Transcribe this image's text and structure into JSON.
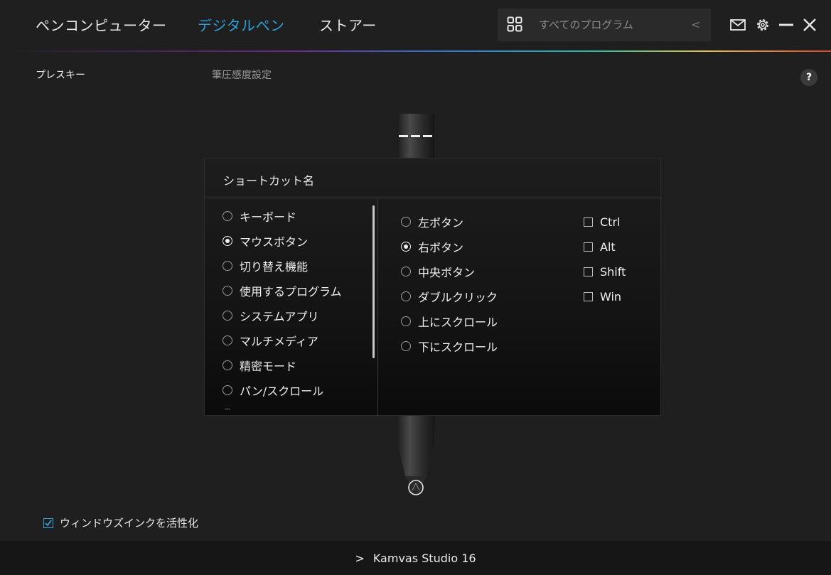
{
  "header": {
    "tabs": [
      {
        "label": "ペンコンピューター",
        "active": false
      },
      {
        "label": "デジタルペン",
        "active": true
      },
      {
        "label": "ストアー",
        "active": false
      }
    ],
    "search": {
      "placeholder": "すべてのプログラム",
      "icon": "grid-icon",
      "back_icon": "chevron-left-icon"
    },
    "icons": [
      "mail-icon",
      "gear-icon",
      "minimize-icon",
      "close-icon"
    ],
    "accent": "#2ea0d8"
  },
  "subtabs": [
    {
      "label": "プレスキー",
      "active": true
    },
    {
      "label": "筆圧感度設定",
      "active": false
    }
  ],
  "help_label": "?",
  "modal": {
    "title": "ショートカット名",
    "categories": [
      {
        "label": "キーボード",
        "checked": false
      },
      {
        "label": "マウスボタン",
        "checked": true
      },
      {
        "label": "切り替え機能",
        "checked": false
      },
      {
        "label": "使用するプログラム",
        "checked": false
      },
      {
        "label": "システムアプリ",
        "checked": false
      },
      {
        "label": "マルチメディア",
        "checked": false
      },
      {
        "label": "精密モード",
        "checked": false
      },
      {
        "label": "パン/スクロール",
        "checked": false
      }
    ],
    "mouse_options": [
      {
        "label": "左ボタン",
        "checked": false
      },
      {
        "label": "右ボタン",
        "checked": true
      },
      {
        "label": "中央ボタン",
        "checked": false
      },
      {
        "label": "ダブルクリック",
        "checked": false
      },
      {
        "label": "上にスクロール",
        "checked": false
      },
      {
        "label": "下にスクロール",
        "checked": false
      }
    ],
    "modifiers": [
      {
        "label": "Ctrl",
        "checked": false
      },
      {
        "label": "Alt",
        "checked": false
      },
      {
        "label": "Shift",
        "checked": false
      },
      {
        "label": "Win",
        "checked": false
      }
    ]
  },
  "windows_ink": {
    "label": "ウィンドウズインクを活性化",
    "checked": true
  },
  "footer": {
    "device": "Kamvas Studio 16"
  }
}
